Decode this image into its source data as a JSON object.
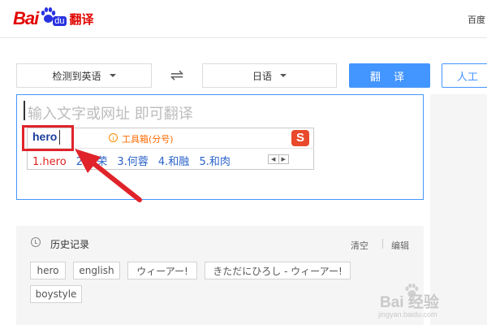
{
  "header": {
    "logo_text": "Bai",
    "logo_du": "du",
    "logo_product": "翻译",
    "top_right": "百度"
  },
  "lang": {
    "source": "检测到英语",
    "target": "日语",
    "swap_symbol": "⇌",
    "translate_button": "翻 译",
    "human_button": "人工"
  },
  "input": {
    "placeholder": "输入文字或网址 即可翻译"
  },
  "ime": {
    "composition": "hero",
    "toolbox_label": "工具箱(分号)",
    "logo_letter": "S",
    "candidates": [
      "1.hero",
      "2.何荣",
      "3.何蓉",
      "4.和融",
      "5.和肉"
    ],
    "pager_prev": "◀",
    "pager_next": "▶"
  },
  "history": {
    "title": "历史记录",
    "clear": "清空",
    "edit": "编辑",
    "items": [
      "hero",
      "english",
      "ウィーアー!",
      "きただにひろし - ウィーアー!",
      "boystyle"
    ]
  },
  "watermark": {
    "line1": "Bai 经验",
    "line2": "jingyan.baidu.com"
  },
  "colors": {
    "accent": "#4395ff",
    "brand_red": "#e10602",
    "annotation_red": "#e0232a"
  }
}
